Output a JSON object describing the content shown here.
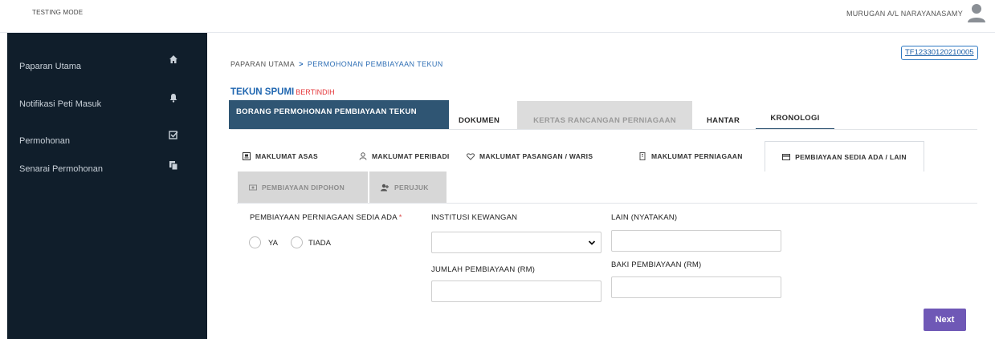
{
  "topbar": {
    "mode": "TESTING MODE",
    "user_name": "MURUGAN A/L NARAYANASAMY"
  },
  "sidebar": {
    "items": [
      {
        "label": "Paparan Utama",
        "icon": "home-icon"
      },
      {
        "label": "Notifikasi Peti Masuk",
        "icon": "bell-icon"
      },
      {
        "label": "Permohonan",
        "icon": "checkbox-icon"
      },
      {
        "label": "Senarai Permohonan",
        "icon": "copy-icon"
      }
    ]
  },
  "breadcrumb": {
    "home": "PAPARAN UTAMA",
    "separator": ">",
    "current": "PERMOHONAN PEMBIAYAAN TEKUN"
  },
  "reference_no": "TF12330120210005",
  "page_title": {
    "title": "TEKUN SPUMI",
    "tag": "BERTINDIH"
  },
  "tabs": {
    "borang": "BORANG PERMOHONAN PEMBIAYAAN TEKUN",
    "dokumen": "DOKUMEN",
    "kertas": "KERTAS RANCANGAN PERNIAGAAN",
    "hantar": "HANTAR",
    "kronologi": "KRONOLOGI"
  },
  "subtabs": {
    "asas": "MAKLUMAT ASAS",
    "peribadi": "MAKLUMAT PERIBADI",
    "pasangan": "MAKLUMAT PASANGAN / WARIS",
    "perniagaan": "MAKLUMAT PERNIAGAAN",
    "sedia_ada": "PEMBIAYAAN SEDIA ADA / LAIN",
    "dipohon": "PEMBIAYAAN DIPOHON",
    "perujuk": "PERUJUK"
  },
  "form": {
    "sedia_ada_label": "PEMBIAYAAN PERNIAGAAN SEDIA ADA",
    "required_mark": "*",
    "option_ya": "YA",
    "option_tiada": "TIADA",
    "institusi_label": "INSTITUSI KEWANGAN",
    "institusi_value": "",
    "lain_label": "LAIN (NYATAKAN)",
    "lain_value": "",
    "jumlah_label": "JUMLAH PEMBIAYAAN (RM)",
    "jumlah_value": "",
    "baki_label": "BAKI PEMBIAYAAN (RM)",
    "baki_value": ""
  },
  "next_label": "Next",
  "colors": {
    "sidebar_bg": "#101e2b",
    "active_tab_bg": "#2f5573",
    "accent_blue": "#1f66b0",
    "tag_red": "#e5383b",
    "next_btn": "#6f58b6"
  }
}
